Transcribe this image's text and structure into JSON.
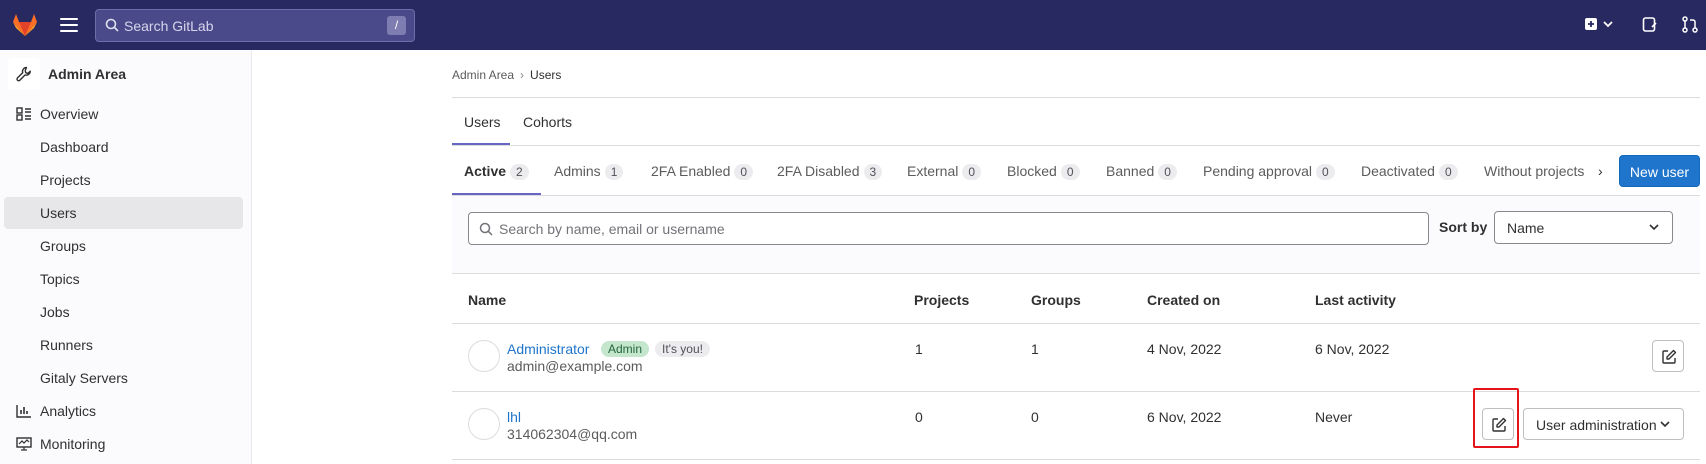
{
  "topbar": {
    "search_placeholder": "Search GitLab",
    "search_shortcut": "/"
  },
  "sidebar": {
    "header": "Admin Area",
    "overview": "Overview",
    "items": [
      {
        "label": "Dashboard"
      },
      {
        "label": "Projects"
      },
      {
        "label": "Users",
        "active": true
      },
      {
        "label": "Groups"
      },
      {
        "label": "Topics"
      },
      {
        "label": "Jobs"
      },
      {
        "label": "Runners"
      },
      {
        "label": "Gitaly Servers"
      }
    ],
    "analytics": "Analytics",
    "monitoring": "Monitoring"
  },
  "breadcrumb": {
    "parent": "Admin Area",
    "current": "Users"
  },
  "primary_tabs": [
    {
      "label": "Users",
      "active": true
    },
    {
      "label": "Cohorts"
    }
  ],
  "filter_tabs": [
    {
      "label": "Active",
      "count": "2",
      "active": true
    },
    {
      "label": "Admins",
      "count": "1"
    },
    {
      "label": "2FA Enabled",
      "count": "0"
    },
    {
      "label": "2FA Disabled",
      "count": "3"
    },
    {
      "label": "External",
      "count": "0"
    },
    {
      "label": "Blocked",
      "count": "0"
    },
    {
      "label": "Banned",
      "count": "0"
    },
    {
      "label": "Pending approval",
      "count": "0"
    },
    {
      "label": "Deactivated",
      "count": "0"
    },
    {
      "label": "Without projects"
    }
  ],
  "new_user_label": "New user",
  "user_search_placeholder": "Search by name, email or username",
  "sort": {
    "label": "Sort by",
    "value": "Name"
  },
  "table": {
    "headers": {
      "name": "Name",
      "projects": "Projects",
      "groups": "Groups",
      "created": "Created on",
      "last_activity": "Last activity"
    },
    "rows": [
      {
        "name": "Administrator",
        "badge_admin": "Admin",
        "badge_you": "It's you!",
        "email": "admin@example.com",
        "projects": "1",
        "groups": "1",
        "created": "4 Nov, 2022",
        "last_activity": "6 Nov, 2022"
      },
      {
        "name": "lhl",
        "email": "314062304@qq.com",
        "projects": "0",
        "groups": "0",
        "created": "6 Nov, 2022",
        "last_activity": "Never"
      }
    ],
    "user_admin_label": "User administration"
  },
  "colors": {
    "topbar": "#292961",
    "primary_button": "#1f75cb",
    "tab_underline": "#6666c4",
    "highlight": "#e6131b"
  }
}
